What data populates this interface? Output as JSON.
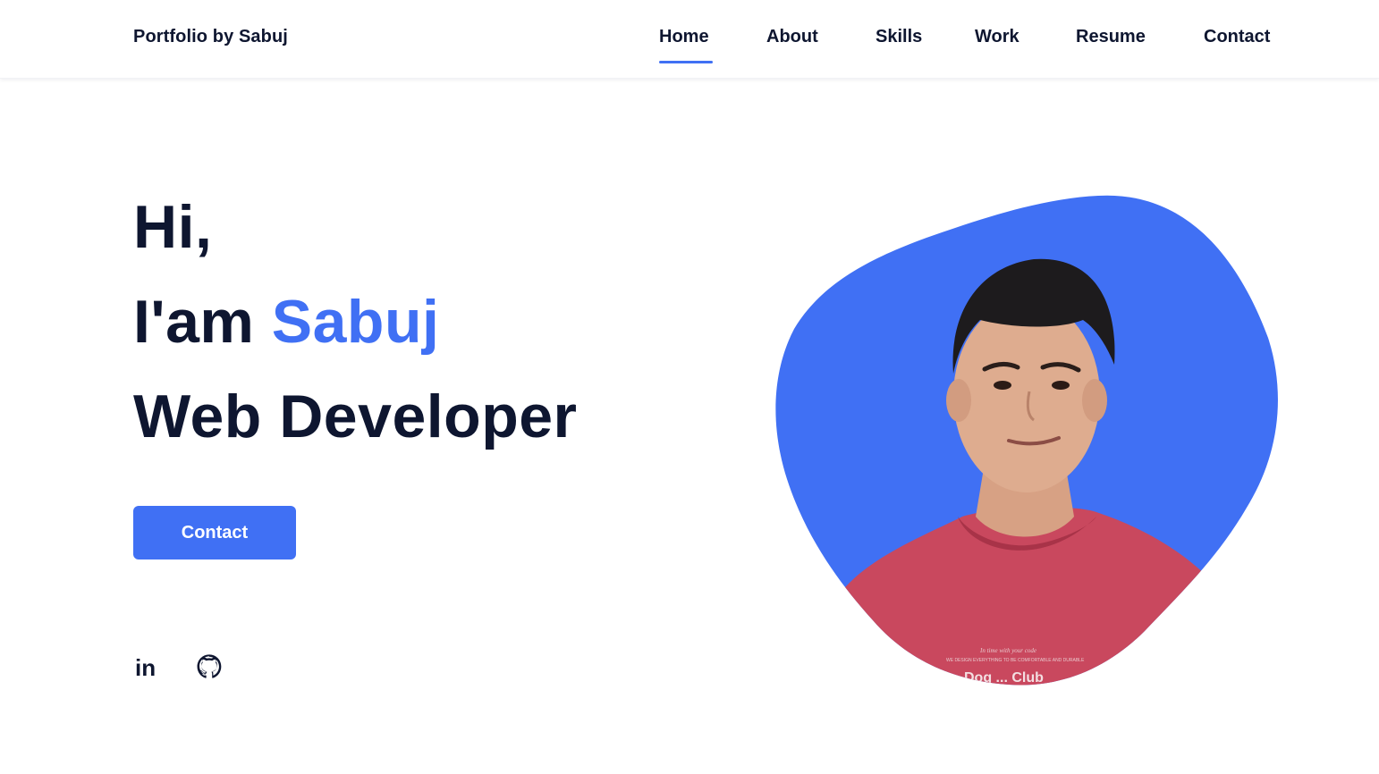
{
  "header": {
    "brand": "Portfolio by Sabuj",
    "nav": [
      {
        "label": "Home",
        "active": true
      },
      {
        "label": "About"
      },
      {
        "label": "Skills"
      },
      {
        "label": "Work"
      },
      {
        "label": "Resume"
      },
      {
        "label": "Contact"
      }
    ]
  },
  "hero": {
    "greeting": "Hi,",
    "intro_prefix": "I'am ",
    "name": "Sabuj",
    "role": "Web Developer",
    "button_label": "Contact"
  },
  "social": [
    {
      "icon": "linkedin-icon",
      "label": "in"
    },
    {
      "icon": "github-icon"
    }
  ],
  "image": {
    "shirt_text_1": "In time with your code",
    "shirt_text_2": "WE DESIGN EVERYTHING TO BE COMFORTABLE AND DURABLE",
    "shirt_text_3": "Dog ... Club"
  },
  "colors": {
    "accent": "#4070f4",
    "text": "#0e1630",
    "background": "#ffffff",
    "shirt": "#c9485e"
  }
}
